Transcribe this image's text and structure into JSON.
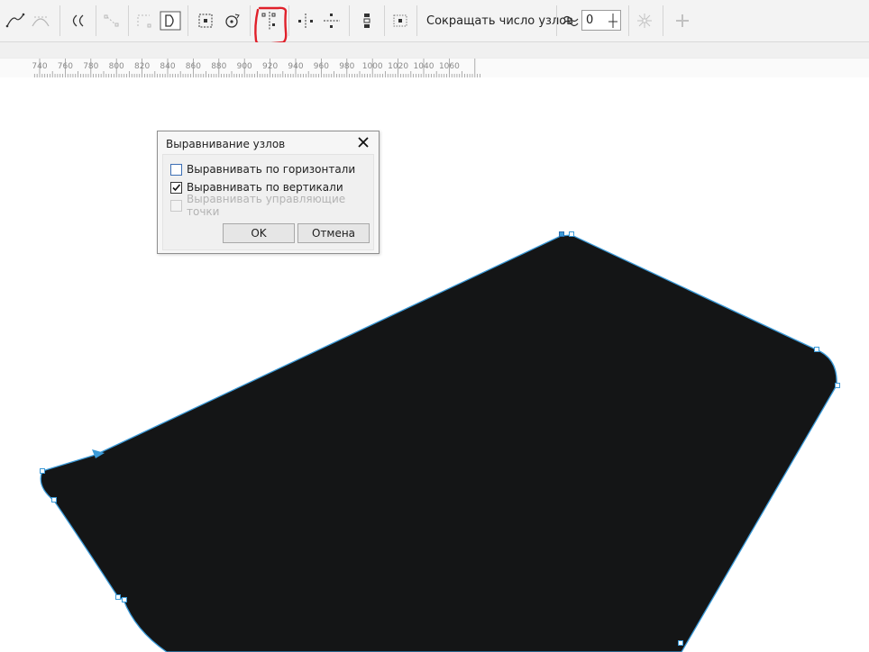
{
  "toolbar": {
    "reduce_nodes_label": "Сокращать число узлов",
    "smoothness_value": "0",
    "icons": [
      "make-node-cusp-icon",
      "make-node-smooth-icon",
      "reverse-direction-icon",
      "extend-curve-icon",
      "extract-subpath-icon",
      "close-curve-icon",
      "select-all-nodes-icon",
      "rotate-nodes-icon",
      "align-nodes-icon",
      "mirror-horizontal-icon",
      "mirror-vertical-icon",
      "elastic-mode-icon",
      "select-nodes-icon",
      "smoothness-icon",
      "more-options-icon",
      "add-icon"
    ]
  },
  "ruler": {
    "labels": [
      "740",
      "760",
      "780",
      "800",
      "820",
      "840",
      "860",
      "880",
      "900",
      "920",
      "940",
      "960",
      "980",
      "1000",
      "1020",
      "1040",
      "1060"
    ]
  },
  "dialog": {
    "title": "Выравнивание узлов",
    "options": [
      {
        "label": "Выравнивать по горизонтали",
        "checked": false,
        "disabled": false
      },
      {
        "label": "Выравнивать по вертикали",
        "checked": true,
        "disabled": false
      },
      {
        "label": "Выравнивать управляющие точки",
        "checked": false,
        "disabled": true
      }
    ],
    "ok_label": "OK",
    "cancel_label": "Отмена"
  },
  "colors": {
    "shape_fill": "#141516",
    "outline": "#3b9ad8",
    "annotation": "#e0202a"
  }
}
